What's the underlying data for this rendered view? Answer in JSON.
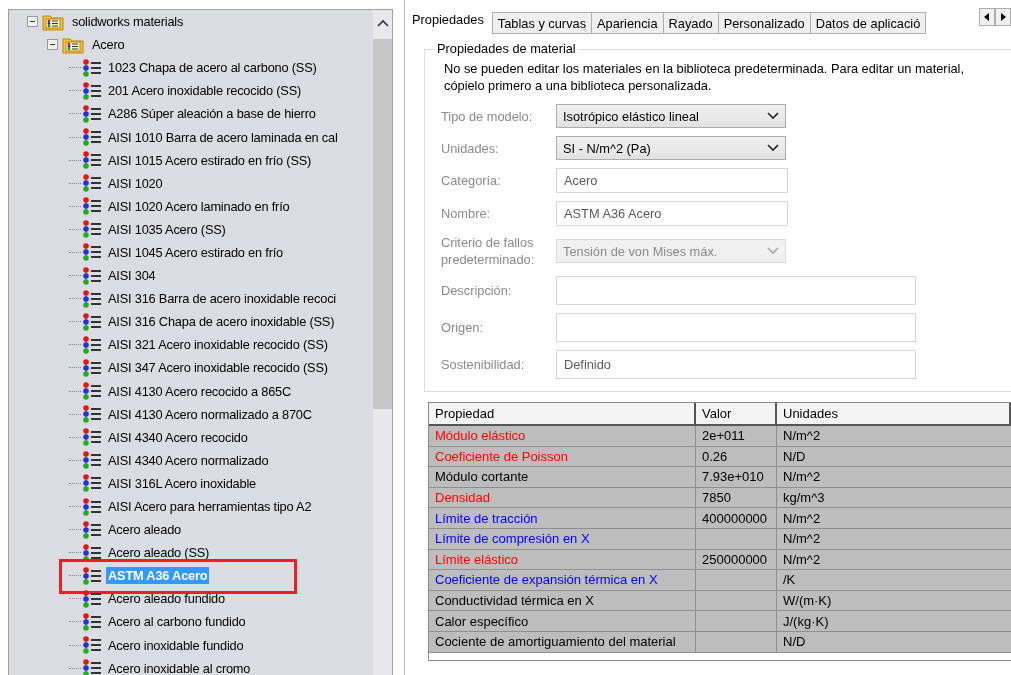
{
  "tree": {
    "label": "solidworks materials",
    "expanded": true,
    "children": [
      {
        "label": "Acero",
        "expanded": true,
        "children": [
          {
            "label": "1023 Chapa de acero al carbono (SS)",
            "selected": false,
            "highlighted": false
          },
          {
            "label": "201 Acero inoxidable recocido (SS)",
            "selected": false,
            "highlighted": false
          },
          {
            "label": "A286 Súper aleación a base de hierro",
            "selected": false,
            "highlighted": false
          },
          {
            "label": "AISI 1010 Barra de acero laminada en cal",
            "selected": false,
            "highlighted": false
          },
          {
            "label": "AISI 1015 Acero estirado en frío (SS)",
            "selected": false,
            "highlighted": false
          },
          {
            "label": "AISI 1020",
            "selected": false,
            "highlighted": false
          },
          {
            "label": "AISI 1020 Acero laminado en frío",
            "selected": false,
            "highlighted": false
          },
          {
            "label": "AISI 1035 Acero (SS)",
            "selected": false,
            "highlighted": false
          },
          {
            "label": "AISI 1045 Acero estirado en frío",
            "selected": false,
            "highlighted": false
          },
          {
            "label": "AISI 304",
            "selected": false,
            "highlighted": false
          },
          {
            "label": "AISI 316 Barra de acero inoxidable recoci",
            "selected": false,
            "highlighted": false
          },
          {
            "label": "AISI 316 Chapa de acero inoxidable (SS)",
            "selected": false,
            "highlighted": false
          },
          {
            "label": "AISI 321 Acero inoxidable recocido (SS)",
            "selected": false,
            "highlighted": false
          },
          {
            "label": "AISI 347 Acero inoxidable recocido (SS)",
            "selected": false,
            "highlighted": false
          },
          {
            "label": "AISI 4130 Acero recocido a 865C",
            "selected": false,
            "highlighted": false
          },
          {
            "label": "AISI 4130 Acero normalizado a 870C",
            "selected": false,
            "highlighted": false
          },
          {
            "label": "AISI 4340 Acero recocido",
            "selected": false,
            "highlighted": false
          },
          {
            "label": "AISI 4340 Acero normalizado",
            "selected": false,
            "highlighted": false
          },
          {
            "label": "AISI 316L Acero inoxidable",
            "selected": false,
            "highlighted": false
          },
          {
            "label": "AISI Acero para herramientas tipo A2",
            "selected": false,
            "highlighted": false
          },
          {
            "label": "Acero aleado",
            "selected": false,
            "highlighted": false
          },
          {
            "label": "Acero aleado (SS)",
            "selected": false,
            "highlighted": false
          },
          {
            "label": "ASTM A36 Acero",
            "selected": true,
            "highlighted": true
          },
          {
            "label": "Acero aleado fundido",
            "selected": false,
            "highlighted": false
          },
          {
            "label": "Acero al carbono fundido",
            "selected": false,
            "highlighted": false
          },
          {
            "label": "Acero inoxidable fundido",
            "selected": false,
            "highlighted": false
          },
          {
            "label": "Acero inoxidable al cromo",
            "selected": false,
            "highlighted": false
          }
        ]
      }
    ]
  },
  "tabs": [
    {
      "label": "Propiedades",
      "selected": true
    },
    {
      "label": "Tablas y curvas",
      "selected": false
    },
    {
      "label": "Apariencia",
      "selected": false
    },
    {
      "label": "Rayado",
      "selected": false
    },
    {
      "label": "Personalizado",
      "selected": false
    },
    {
      "label": "Datos de aplicació",
      "selected": false
    }
  ],
  "group": {
    "title": "Propiedades de material",
    "note": "No se pueden editar los materiales en la biblioteca predeterminada. Para editar un material, cópielo primero a una biblioteca personalizada.",
    "fields": [
      {
        "label": "Tipo de modelo:",
        "kind": "select",
        "value": "Isotrópico elástico lineal",
        "disabled": false
      },
      {
        "label": "Unidades:",
        "kind": "select",
        "value": "SI - N/m^2 (Pa)",
        "disabled": false
      },
      {
        "label": "Categoría:",
        "kind": "text",
        "value": "Acero"
      },
      {
        "label": "Nombre:",
        "kind": "text",
        "value": "ASTM A36 Acero"
      },
      {
        "label": "Criterio de fallos predeterminado:",
        "kind": "select",
        "value": "Tensión de von Mises máx.",
        "disabled": true
      },
      {
        "label": "Descripción:",
        "kind": "memo"
      },
      {
        "label": "Origen:",
        "kind": "memo"
      },
      {
        "label": "Sostenibilidad:",
        "kind": "memo",
        "value": "Definido"
      }
    ]
  },
  "table": {
    "columns": [
      "Propiedad",
      "Valor",
      "Unidades"
    ],
    "rows": [
      {
        "property": "Módulo elástico",
        "color": "#ff0000",
        "value": "2e+011",
        "units": "N/m^2"
      },
      {
        "property": "Coeficiente de Poisson",
        "color": "#ff0000",
        "value": "0.26",
        "units": "N/D"
      },
      {
        "property": "Módulo cortante",
        "color": "#000000",
        "value": "7.93e+010",
        "units": "N/m^2"
      },
      {
        "property": "Densidad",
        "color": "#ff0000",
        "value": "7850",
        "units": "kg/m^3"
      },
      {
        "property": "Límite de tracción",
        "color": "#0000ff",
        "value": "400000000",
        "units": "N/m^2"
      },
      {
        "property": "Límite de compresión en X",
        "color": "#0000ff",
        "units": "N/m^2"
      },
      {
        "property": "Límite elástico",
        "color": "#ff0000",
        "value": "250000000",
        "units": "N/m^2"
      },
      {
        "property": "Coeficiente de expansión térmica en X",
        "color": "#0000ff",
        "units": "/K"
      },
      {
        "property": "Conductividad térmica en X",
        "color": "#000000",
        "units": "W/(m·K)"
      },
      {
        "property": "Calor específico",
        "color": "#000000",
        "units": "J/(kg·K)"
      },
      {
        "property": "Cociente de amortiguamiento del material",
        "color": "#000000",
        "units": "N/D"
      }
    ]
  }
}
